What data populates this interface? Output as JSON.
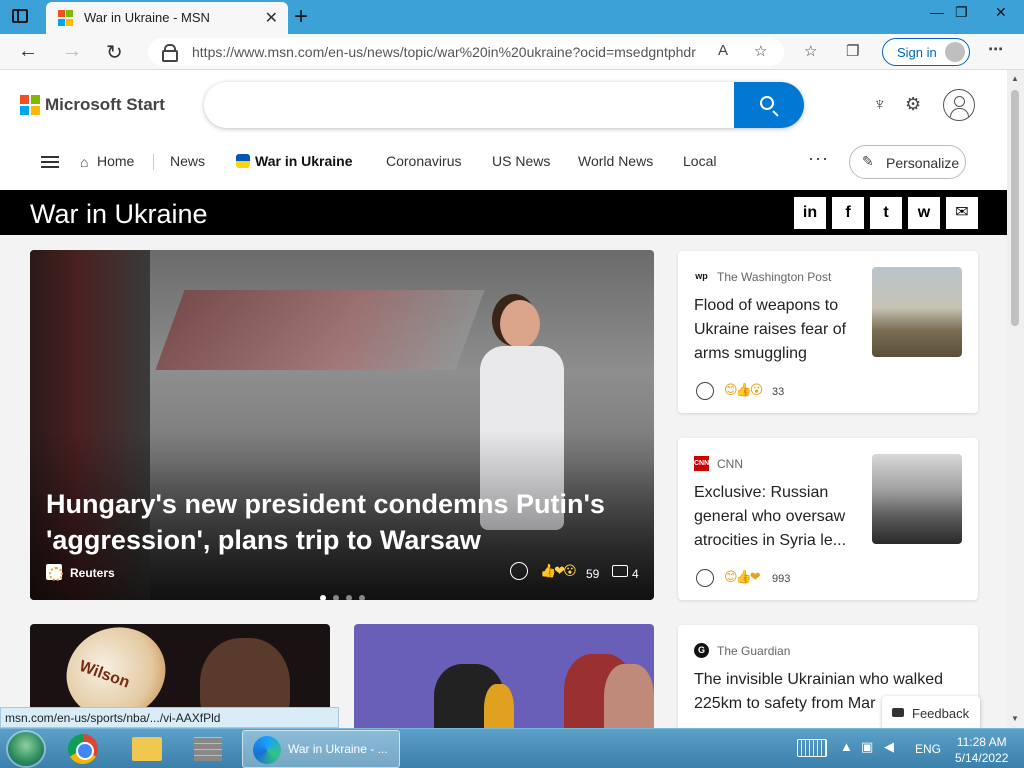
{
  "browser": {
    "tab_title": "War in Ukraine - MSN",
    "tab_close": "✕",
    "new_tab": "+",
    "url": "https://www.msn.com/en-us/news/topic/war%20in%20ukraine?ocid=msedgntphdr",
    "signin_label": "Sign in",
    "win_min": "—",
    "win_restore": "❐",
    "win_close": "✕"
  },
  "msn": {
    "brand": "Microsoft Start",
    "search_placeholder": "",
    "nav": [
      "Home",
      "News",
      "War in Ukraine",
      "Coronavirus",
      "US News",
      "World News",
      "Local"
    ],
    "personalize": "Personalize",
    "more": "···"
  },
  "topic": {
    "title": "War in Ukraine",
    "share": [
      "in",
      "f",
      "t",
      "w",
      "✉"
    ]
  },
  "hero": {
    "headline": "Hungary's new president condemns Putin's 'aggression', plans trip to Warsaw",
    "source": "Reuters",
    "reactions": "59",
    "comments": "4",
    "emojis": "👍❤😮"
  },
  "cards": [
    {
      "source_logo": "wp",
      "source": "The Washington Post",
      "headline": "Flood of weapons to Ukraine raises fear of arms smuggling",
      "reactions": "33",
      "emojis": "😊👍😮"
    },
    {
      "source_logo": "CNN",
      "source": "CNN",
      "headline": "Exclusive: Russian general who oversaw atrocities in Syria le...",
      "reactions": "993",
      "emojis": "😊👍❤"
    },
    {
      "source_logo": "G",
      "source": "The Guardian",
      "headline": "The invisible Ukrainian who walked 225km to safety from Mar"
    }
  ],
  "tile1": {
    "ball_label": "Wilson"
  },
  "feedback": "Feedback",
  "status_url": "msn.com/en-us/sports/nba/.../vi-AAXfPld",
  "taskbar": {
    "task_label": "War in Ukraine - ...",
    "lang": "ENG",
    "time": "11:28 AM",
    "date": "5/14/2022"
  },
  "colors": {
    "accent": "#0078d4",
    "titlebar": "#3ca1d6",
    "ms_logo": [
      "#f25022",
      "#7fba00",
      "#00a4ef",
      "#ffb900"
    ],
    "ukraine_flag": [
      "#0057b7",
      "#ffd700"
    ]
  }
}
